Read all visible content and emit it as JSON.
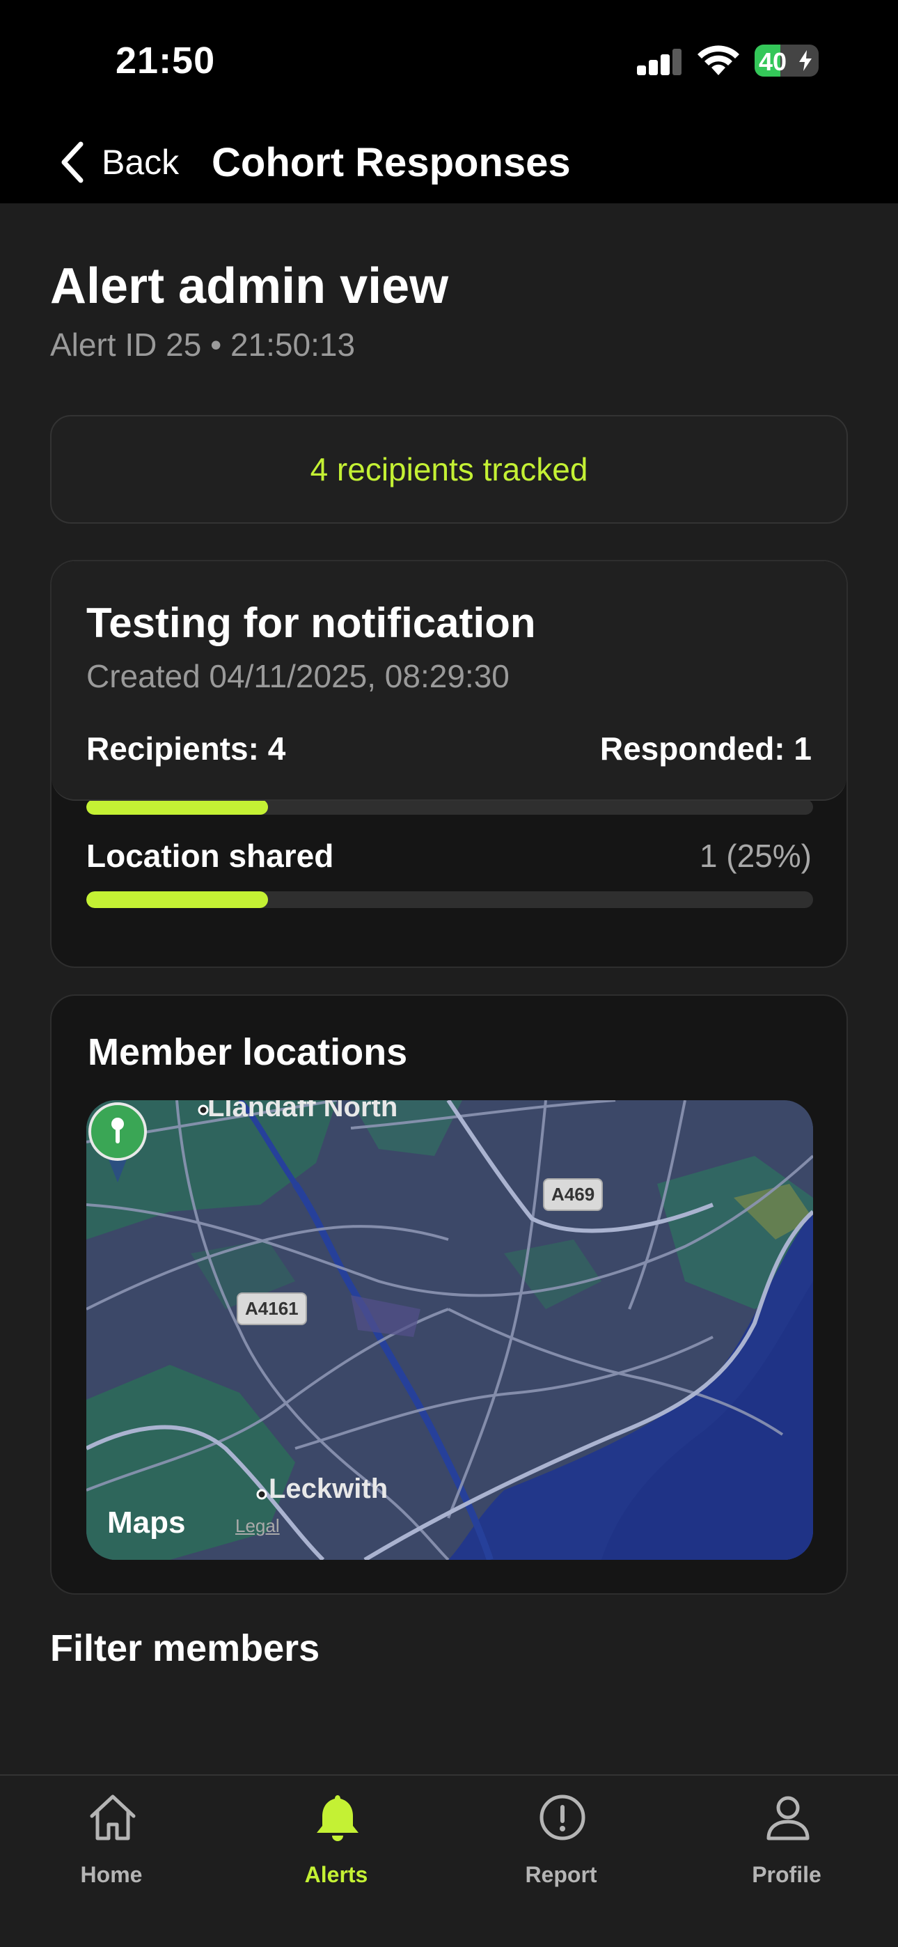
{
  "status_bar": {
    "time": "21:50",
    "battery_level": "40",
    "battery_percent": 40,
    "signal_bars": 3
  },
  "nav": {
    "back_label": "Back",
    "title": "Cohort Responses"
  },
  "header": {
    "title": "Alert admin view",
    "subtitle": "Alert ID 25 • 21:50:13"
  },
  "tracked": {
    "text": "4 recipients tracked"
  },
  "alert_card": {
    "name": "Testing for notification",
    "created": "Created 04/11/2025, 08:29:30",
    "recipients": "Recipients: 4",
    "responded": "Responded: 1",
    "response_progress": 0.25,
    "location_label": "Location shared",
    "location_value": "1 (25%)",
    "location_progress": 0.25
  },
  "map": {
    "title": "Member locations",
    "labels": {
      "top": "Llandaff North",
      "bottom": "Leckwith"
    },
    "roads": [
      "A469",
      "A4161"
    ],
    "brand": "Maps",
    "legal": "Legal",
    "pin_icon": "map-pin-icon"
  },
  "filter": {
    "title": "Filter members"
  },
  "tabs": [
    {
      "label": "Home",
      "icon": "home-icon",
      "active": false
    },
    {
      "label": "Alerts",
      "icon": "bell-icon",
      "active": true
    },
    {
      "label": "Report",
      "icon": "exclamation-icon",
      "active": false
    },
    {
      "label": "Profile",
      "icon": "person-icon",
      "active": false
    }
  ],
  "colors": {
    "accent": "#c4f134",
    "background": "#1e1e1e",
    "card": "#202020",
    "muted_text": "#9a9a9a",
    "pin": "#34a853"
  }
}
